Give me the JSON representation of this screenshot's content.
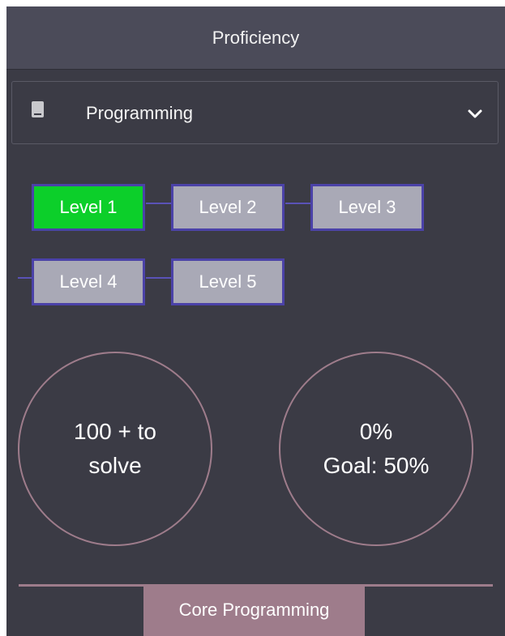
{
  "header": {
    "title": "Proficiency"
  },
  "subject_select": {
    "selected": "Programming",
    "icon": "book-icon",
    "caret": "chevron-down-icon"
  },
  "levels": [
    {
      "label": "Level 1",
      "active": true
    },
    {
      "label": "Level 2",
      "active": false
    },
    {
      "label": "Level 3",
      "active": false
    },
    {
      "label": "Level 4",
      "active": false
    },
    {
      "label": "Level 5",
      "active": false
    }
  ],
  "stats": {
    "to_solve": {
      "line1": "100 + to",
      "line2": "solve"
    },
    "progress": {
      "line1": "0%",
      "line2": "Goal: 50%"
    }
  },
  "footer": {
    "tab_label": "Core Programming"
  },
  "colors": {
    "panel_bg": "#3b3b45",
    "header_bg": "#4b4b59",
    "level_active": "#0ccf2a",
    "level_inactive": "#a9a9b6",
    "level_border": "#4b42a8",
    "accent": "#9e7c8b"
  }
}
